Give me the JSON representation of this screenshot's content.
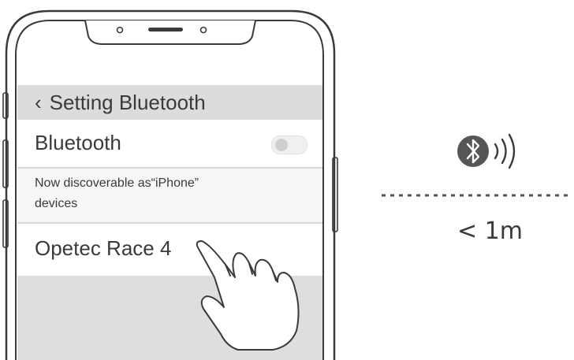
{
  "settings": {
    "nav": {
      "back_icon": "chevron-left-icon",
      "title": "Setting Bluetooth"
    },
    "bluetooth_row": {
      "label": "Bluetooth",
      "toggle_on": false
    },
    "discoverable": {
      "line1": "Now discoverable as“iPhone”",
      "line2": "devices"
    },
    "device": {
      "name": "Opetec Race 4"
    }
  },
  "range": {
    "bluetooth_icon": "bluetooth-icon",
    "signal_icon": "signal-waves-icon",
    "distance_label": "< 1m"
  },
  "colors": {
    "ink": "#3a3a3a",
    "nav_bar": "#dcdcdc",
    "bluetooth_badge": "#555555"
  }
}
